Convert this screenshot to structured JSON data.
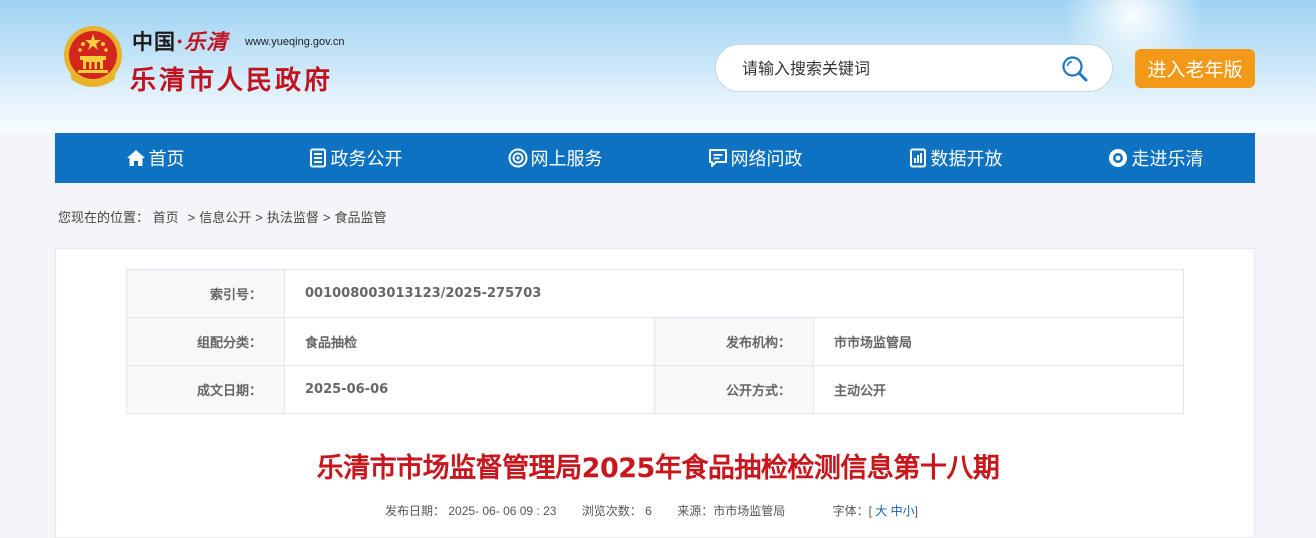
{
  "header": {
    "title_prefix": "中国",
    "title_sep": "·",
    "title_city": "乐清",
    "domain": "www.yueqing.gov.cn",
    "site_name": "乐清市人民政府"
  },
  "search": {
    "placeholder": "请输入搜索关键词",
    "icon": "search-icon"
  },
  "elder_button": "进入老年版",
  "nav": {
    "items": [
      {
        "label": "首页",
        "icon": "home-icon"
      },
      {
        "label": "政务公开",
        "icon": "document-icon"
      },
      {
        "label": "网上服务",
        "icon": "service-icon"
      },
      {
        "label": "网络问政",
        "icon": "message-icon"
      },
      {
        "label": "数据开放",
        "icon": "data-icon"
      },
      {
        "label": "走进乐清",
        "icon": "eye-icon"
      }
    ]
  },
  "breadcrumb": {
    "prefix": "您现在的位置：",
    "items": [
      "首页",
      "信息公开",
      "执法监督",
      "食品监管"
    ]
  },
  "meta": {
    "index_label": "索引号：",
    "index_value": "001008003013123/2025-275703",
    "category_label": "组配分类：",
    "category_value": "食品抽检",
    "publisher_label": "发布机构：",
    "publisher_value": "市市场监管局",
    "date_label": "成文日期：",
    "date_value": "2025-06-06",
    "method_label": "公开方式：",
    "method_value": "主动公开"
  },
  "article": {
    "title": "乐清市市场监督管理局2025年食品抽检检测信息第十八期",
    "publish_label": "发布日期：",
    "publish_value": "2025- 06- 06 09 : 23",
    "views_label": "浏览次数：",
    "views_value": "6",
    "source_label": "来源：",
    "source_value": "市市场监管局",
    "font_label": "字体：",
    "font_open": "[",
    "font_large": "大",
    "font_medium": "中",
    "font_small": "小",
    "font_close": "]"
  },
  "colors": {
    "nav_bg": "#0d72c1",
    "accent_orange": "#f29a18",
    "title_red": "#c8161d"
  }
}
